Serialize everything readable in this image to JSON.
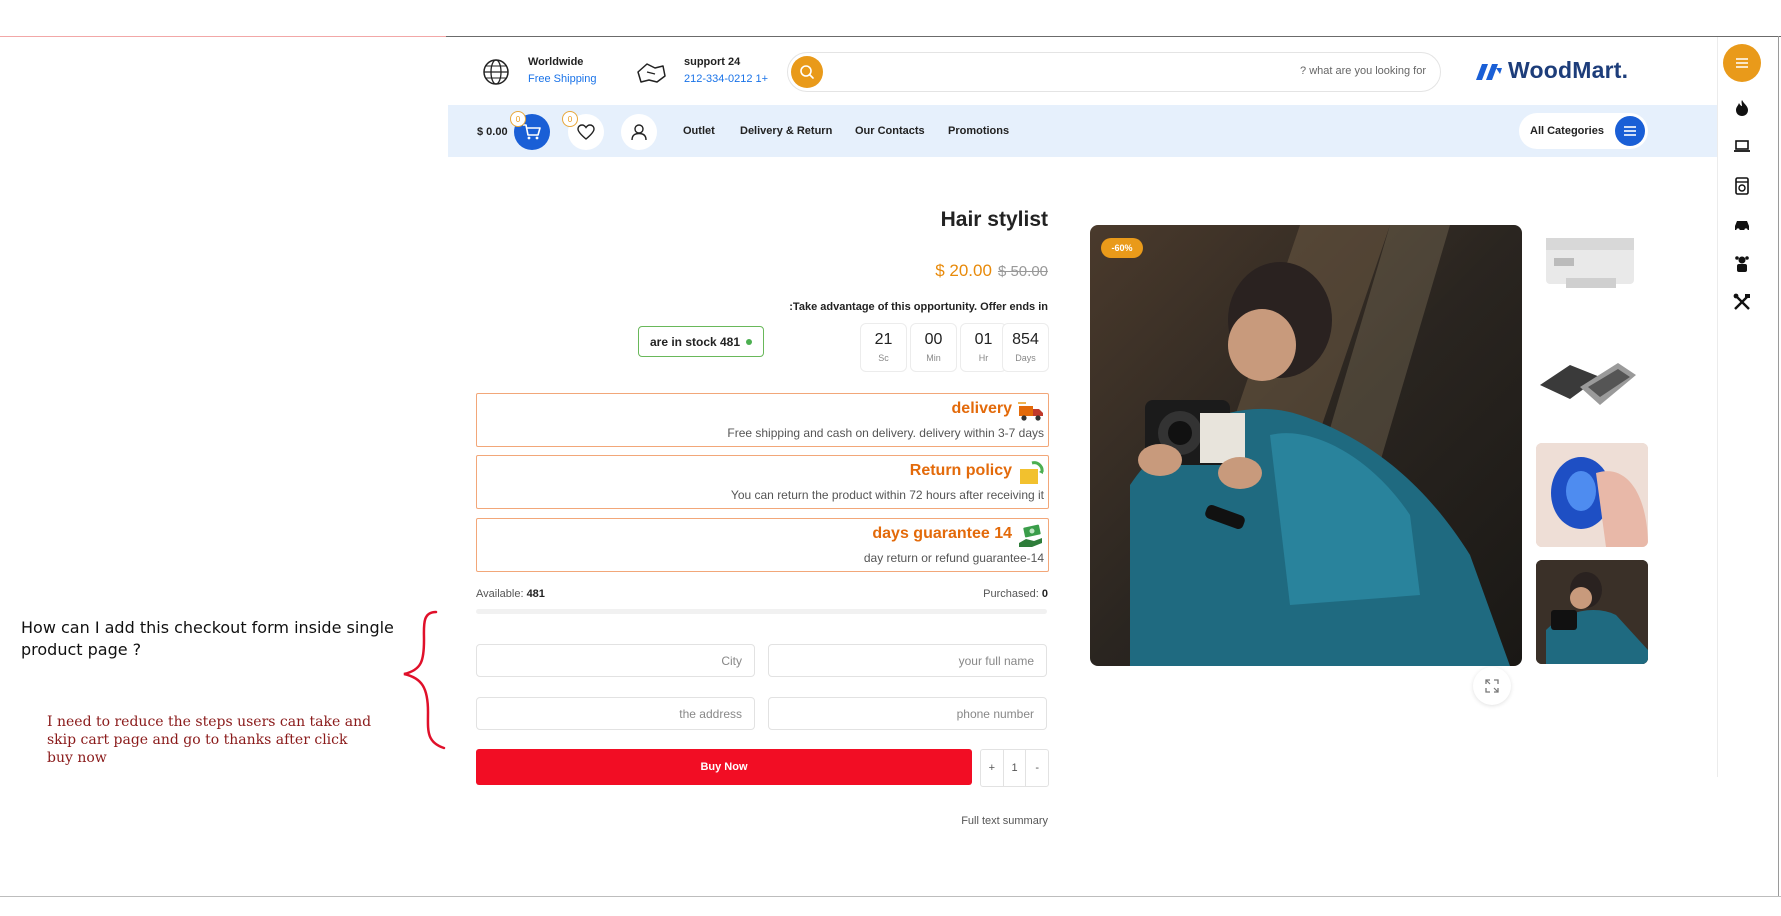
{
  "header": {
    "shipping_title": "Worldwide",
    "shipping_sub": "Free Shipping",
    "support_title": "support 24",
    "support_phone": "212-334-0212 1+",
    "search_placeholder": "? what are you looking for",
    "logo_text": "WoodMart."
  },
  "navbar": {
    "cart_price": "$ 0.00",
    "cart_count": "0",
    "wishlist_count": "0",
    "links": [
      "Outlet",
      "Delivery & Return",
      "Our Contacts",
      "Promotions"
    ],
    "all_categories": "All Categories"
  },
  "sidebar": {
    "icons": [
      "fire-icon",
      "laptop-icon",
      "appliance-icon",
      "car-icon",
      "toy-icon",
      "tools-icon"
    ]
  },
  "product": {
    "title": "Hair stylist",
    "price": "$ 20.00",
    "old_price": "$ 50.00",
    "offer_text": ":Take advantage of this opportunity. Offer ends in",
    "stock_text": "are in stock 481",
    "countdown": [
      {
        "value": "21",
        "label": "Sc"
      },
      {
        "value": "00",
        "label": "Min"
      },
      {
        "value": "01",
        "label": "Hr"
      },
      {
        "value": "854",
        "label": "Days"
      }
    ],
    "info": [
      {
        "title": "delivery",
        "sub": "Free shipping and cash on delivery. delivery within 3-7 days",
        "icon": "delivery-truck-icon"
      },
      {
        "title": "Return policy",
        "sub": "You can return the product within 72 hours after receiving it",
        "icon": "return-box-icon"
      },
      {
        "title": "days guarantee 14",
        "sub": "day return or refund guarantee-14",
        "icon": "money-hand-icon"
      }
    ],
    "available_label": "Available:",
    "available_value": "481",
    "purchased_label": "Purchased:",
    "purchased_value": "0",
    "sold_fraction": 0,
    "form": {
      "city": "City",
      "full_name": "your full name",
      "address": "the address",
      "phone": "phone number"
    },
    "buy_now": "Buy Now",
    "qty_plus": "+",
    "qty_value": "1",
    "qty_minus": "-",
    "summary_link": "Full text summary",
    "sale_badge": "-60%"
  },
  "annotation": {
    "question": "How can I add this checkout form inside single product page ?",
    "note": "I need to reduce the steps users can take and skip cart page and go to thanks after click buy now"
  },
  "colors": {
    "accent_orange": "#e99a1a",
    "brand_blue": "#1a5fd6",
    "buy_red": "#f20d24",
    "info_orange": "#e36a0a",
    "nav_bg": "#e6f0fc"
  }
}
